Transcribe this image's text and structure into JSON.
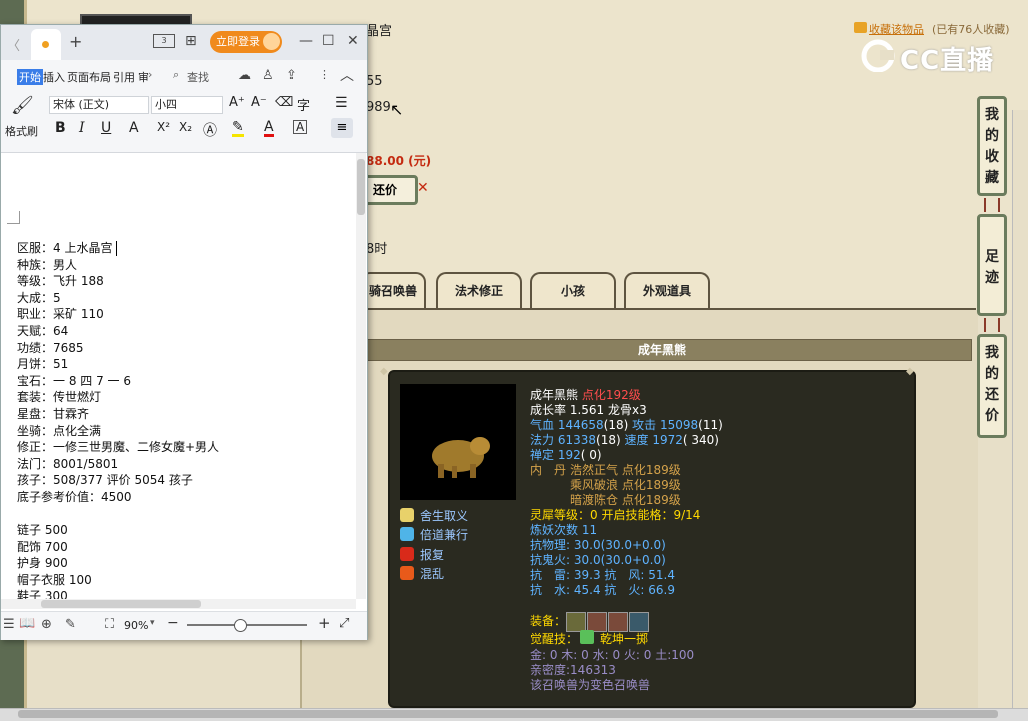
{
  "game_page": {
    "server_fragment": "晶宫",
    "fav_link": "收藏该物品",
    "fav_count": "(已有76人收藏)",
    "cc_logo": "CC直播",
    "frag_55": "55",
    "frag_989": "989",
    "price": "88.00 (元)",
    "counter_btn": "还价",
    "frag_time": "8时",
    "tabs": [
      "骑召唤兽",
      "法术修正",
      "小孩",
      "外观道具"
    ],
    "pet_header": "成年黑熊",
    "side_buttons": [
      "我的收藏",
      "足迹",
      "我的还价"
    ]
  },
  "pet": {
    "name": "成年黑熊",
    "name_level": "点化192级",
    "growth": "成长率 1.561 龙骨x3",
    "hp_label": "气血",
    "hp": "144658",
    "hp_n": "(18)",
    "atk_label": "攻击",
    "atk": "15098",
    "atk_n": "(11)",
    "mp_label": "法力",
    "mp": "61338",
    "mp_n": "(18)",
    "spd_label": "速度",
    "spd": "1972",
    "spd_n": "( 340)",
    "zen_label": "禅定",
    "zen": "192",
    "zen_n": "( 0)",
    "neidan_label": "内　丹",
    "neidan": [
      "浩然正气 点化189级",
      "乘风破浪 点化189级",
      "暗渡陈仓 点化189级"
    ],
    "lingxi": "灵犀等级：0 开启技能格：9/14",
    "lianyao": "炼妖次数 11",
    "res1": "抗物理: 30.0(30.0+0.0)",
    "res2": "抗鬼火: 30.0(30.0+0.0)",
    "res3": "抗　雷: 39.3 抗　风: 51.4",
    "res4": "抗　水: 45.4 抗　火: 66.9",
    "equip_label": "装备：",
    "awaken_label": "觉醒技：",
    "awaken": "乾坤一掷",
    "elements": "金: 0 木: 0 水: 0 火: 0 土:100",
    "intimacy": "亲密度:146313",
    "note": "该召唤兽为变色召唤兽",
    "skills": [
      "舍生取义",
      "倍道兼行",
      "报复",
      "混乱"
    ]
  },
  "wps": {
    "tab_new": "+",
    "login": "立即登录",
    "ribbon_tabs": [
      "开始",
      "插入",
      "页面布局",
      "引用",
      "审"
    ],
    "search": "查找",
    "format_painter": "格式刷",
    "font_name": "宋体 (正文)",
    "font_size": "小四",
    "zoom": "90%",
    "doc_lines": [
      "区服：4 上水晶宫",
      "种族：男人",
      "等级：飞升 188",
      "大成：5",
      "职业：采矿 110",
      "天赋：64",
      "功绩：7685",
      "月饼：51",
      "宝石：一 8 四 7 一 6",
      "套装：传世燃灯",
      "星盘：甘霖齐",
      "坐骑：点化全满",
      "修正：一修三世男魔、二修女魔+男人",
      "法门：8001/5801",
      "孩子：508/377 评价 5054 孩子",
      "底子参考价值：4500",
      "",
      "链子 500",
      "配饰 700",
      "护身 900",
      "帽子衣服 100",
      "鞋子 300"
    ]
  }
}
